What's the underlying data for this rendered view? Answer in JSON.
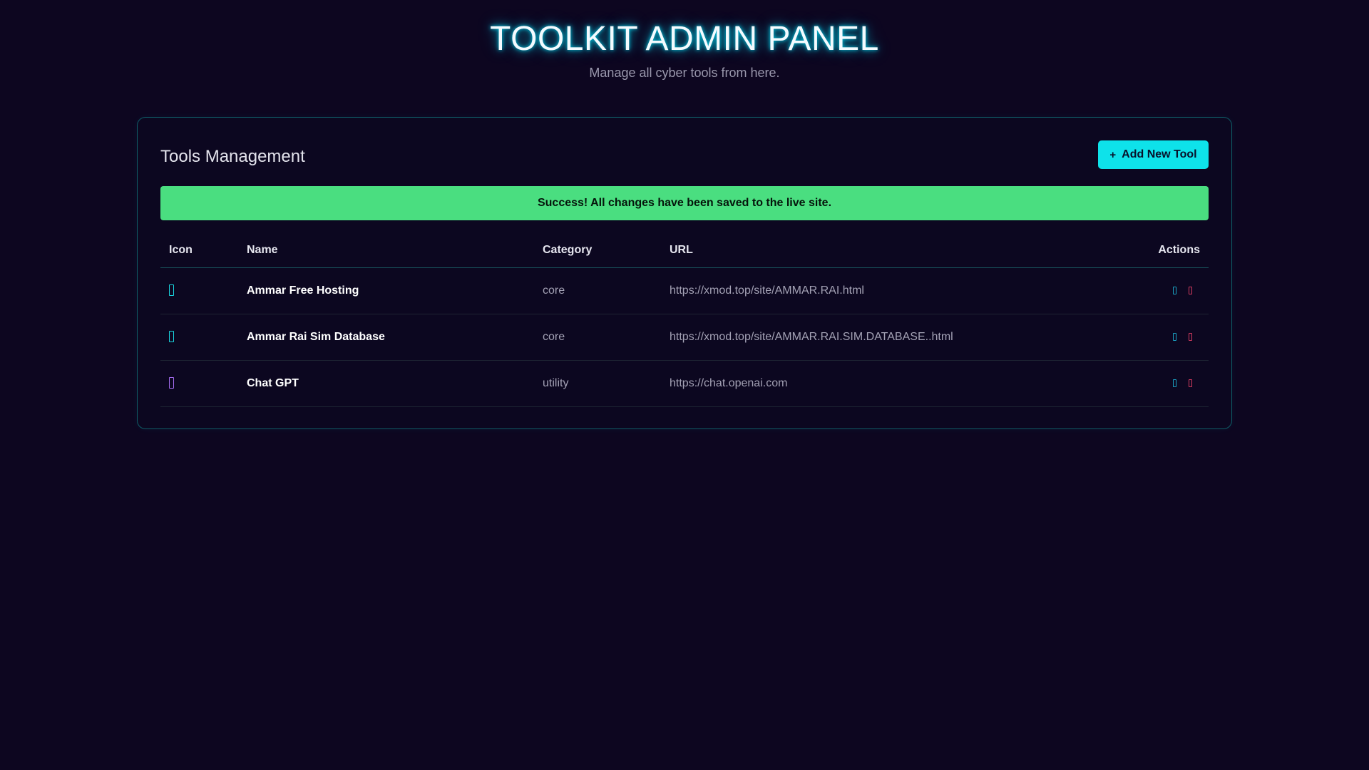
{
  "header": {
    "title": "TOOLKIT ADMIN PANEL",
    "subtitle": "Manage all cyber tools from here."
  },
  "panel": {
    "title": "Tools Management",
    "add_button": {
      "icon": "plus-icon",
      "label": "Add New Tool"
    },
    "alert": "Success! All changes have been saved to the live site."
  },
  "table": {
    "columns": [
      "Icon",
      "Name",
      "Category",
      "URL",
      "Actions"
    ],
    "rows": [
      {
        "icon": "tool-icon",
        "name": "Ammar Free Hosting",
        "category": "core",
        "url": "https://xmod.top/site/AMMAR.RAI.html",
        "actions": [
          "edit-icon",
          "delete-icon"
        ]
      },
      {
        "icon": "tool-icon",
        "name": "Ammar Rai Sim Database",
        "category": "core",
        "url": "https://xmod.top/site/AMMAR.RAI.SIM.DATABASE..html",
        "actions": [
          "edit-icon",
          "delete-icon"
        ]
      },
      {
        "icon": "tool-icon",
        "name": "Chat GPT",
        "category": "utility",
        "url": "https://chat.openai.com",
        "actions": [
          "edit-icon",
          "delete-icon"
        ]
      }
    ]
  },
  "colors": {
    "background": "#0d0620",
    "accent": "#0ee2ea",
    "success": "#4ade80",
    "edit": "#1aa3c4",
    "delete": "#d23a5e",
    "core_icon": "#19d6e0",
    "utility_icon": "#a56cf0"
  }
}
